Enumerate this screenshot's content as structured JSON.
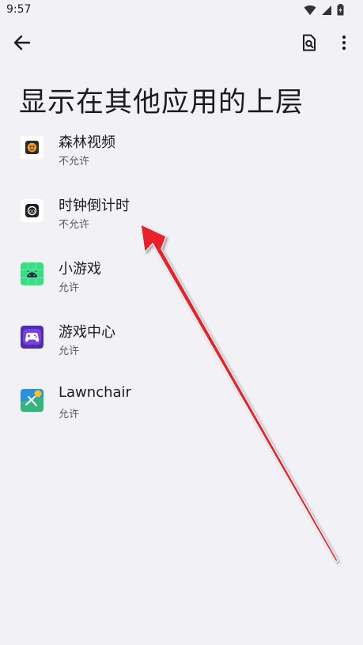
{
  "status_bar": {
    "time": "9:57"
  },
  "header": {
    "title": "显示在其他应用的上层"
  },
  "apps": [
    {
      "name": "森林视频",
      "status": "不允许",
      "icon": "forest-video-icon"
    },
    {
      "name": "时钟倒计时",
      "status": "不允许",
      "icon": "clock-countdown-icon"
    },
    {
      "name": "小游戏",
      "status": "允许",
      "icon": "android-game-icon"
    },
    {
      "name": "游戏中心",
      "status": "允许",
      "icon": "gamepad-icon"
    },
    {
      "name": "Lawnchair",
      "status": "允许",
      "icon": "lawnchair-icon"
    }
  ],
  "colors": {
    "background": "#f2f1f6",
    "annotation_arrow": "#e8202a"
  }
}
